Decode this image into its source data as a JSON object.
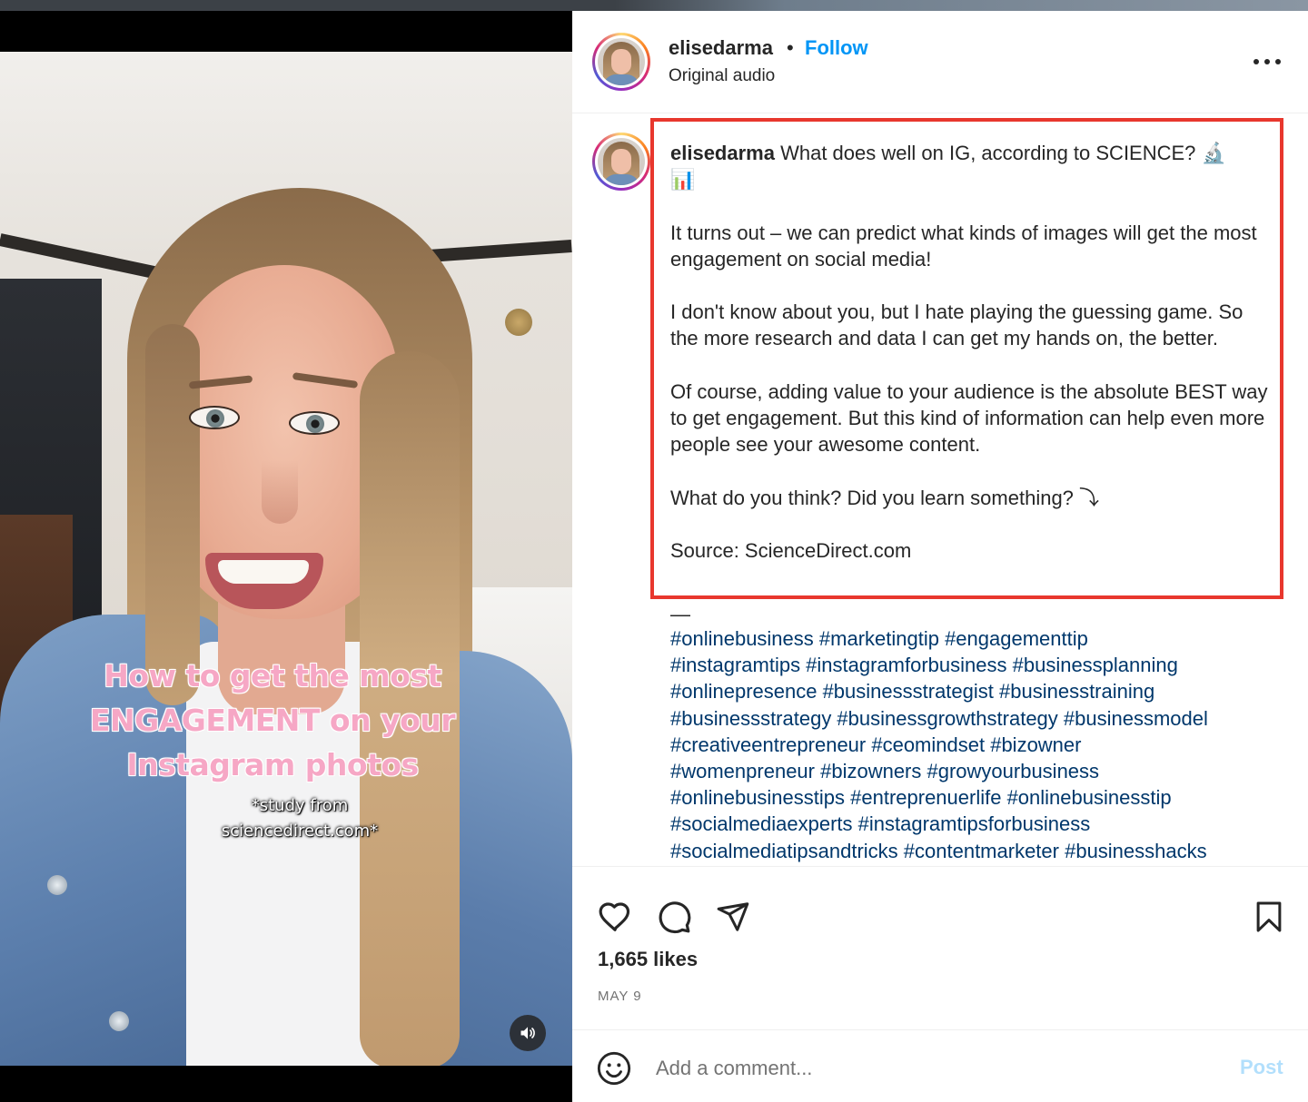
{
  "video": {
    "overlay_title_lines": [
      "How to get the most",
      "ENGAGEMENT on your",
      "Instagram photos"
    ],
    "overlay_sub_lines": [
      "*study from",
      "sciencedirect.com*"
    ],
    "sound_icon": "speaker-icon"
  },
  "header": {
    "username": "elisedarma",
    "separator": "•",
    "follow_label": "Follow",
    "audio_label": "Original audio",
    "more_icon": "more-options-icon"
  },
  "caption": {
    "username": "elisedarma",
    "first_line": "What does well on IG, according to SCIENCE? 🔬",
    "first_line_cont": "📊",
    "para1": "It turns out – we can predict what kinds of images will get the most engagement on social media!",
    "para2": "I don't know about you, but I hate playing the guessing game. So the more research and data I can get my hands on, the better.",
    "para3": "Of course, adding value to your audience is the absolute BEST way to get engagement. But this kind of information can help even more people see your awesome content.",
    "para4": "What do you think? Did you learn something? ⤵",
    "source": "Source: ScienceDirect.com",
    "dash": "—",
    "hashtag_lines": [
      "#onlinebusiness #marketingtip #engagementtip",
      "#instagramtips #instagramforbusiness #businessplanning",
      "#onlinepresence #businessstrategist #businesstraining",
      "#businessstrategy #businessgrowthstrategy #businessmodel",
      "#creativeentrepreneur #ceomindset #bizowner",
      "#womenpreneur #bizowners #growyourbusiness",
      "#onlinebusinesstips #entreprenuerlife #onlinebusinesstip",
      "#socialmediaexperts #instagramtipsforbusiness",
      "#socialmediatipsandtricks #contentmarketer #businesshacks"
    ]
  },
  "actions": {
    "like_icon": "heart-icon",
    "comment_icon": "comment-icon",
    "share_icon": "share-icon",
    "save_icon": "bookmark-icon",
    "likes": "1,665 likes",
    "date": "MAY 9"
  },
  "comment": {
    "placeholder": "Add a comment...",
    "post_label": "Post",
    "emoji_icon": "emoji-icon"
  },
  "colors": {
    "follow": "#0095f6",
    "hashtag": "#00376b",
    "highlight_border": "#e8372d",
    "post_disabled": "#b2dffc",
    "overlay_title": "#f6a7c5"
  }
}
